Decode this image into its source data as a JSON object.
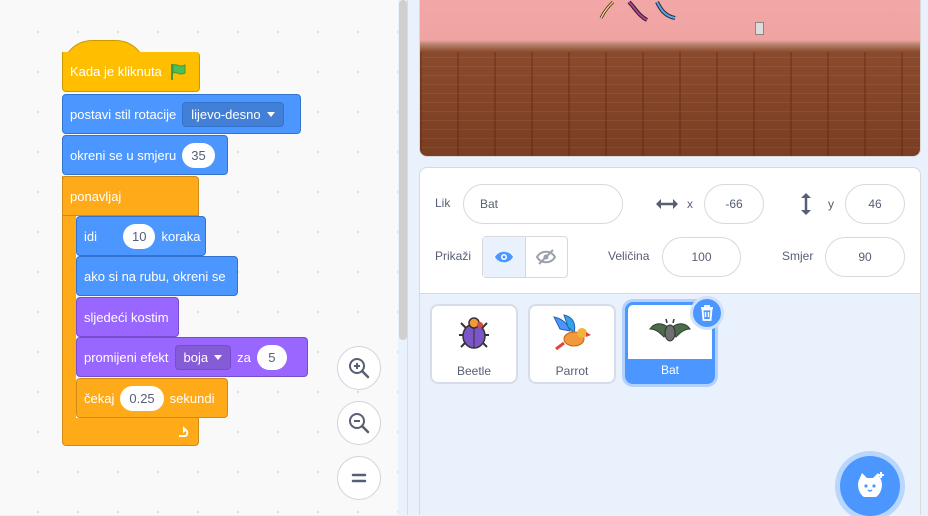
{
  "code": {
    "when_flag": "Kada je kliknuta",
    "set_rotation": {
      "label": "postavi stil rotacije",
      "value": "lijevo-desno"
    },
    "point": {
      "label": "okreni se u smjeru",
      "value": "35"
    },
    "forever": "ponavljaj",
    "move": {
      "pre": "idi",
      "value": "10",
      "post": "koraka"
    },
    "bounce": "ako si na rubu, okreni se",
    "next_costume": "sljedeći kostim",
    "change_effect": {
      "label": "promijeni efekt",
      "effect": "boja",
      "by": "za",
      "value": "5"
    },
    "wait": {
      "pre": "čekaj",
      "value": "0.25",
      "post": "sekundi"
    }
  },
  "sprite_info": {
    "sprite_label": "Lik",
    "sprite_name": "Bat",
    "x_label": "x",
    "x_value": "-66",
    "y_label": "y",
    "y_value": "46",
    "show_label": "Prikaži",
    "size_label": "Veličina",
    "size_value": "100",
    "direction_label": "Smjer",
    "direction_value": "90"
  },
  "sprites": [
    {
      "name": "Beetle",
      "selected": false
    },
    {
      "name": "Parrot",
      "selected": false
    },
    {
      "name": "Bat",
      "selected": true
    }
  ],
  "colors": {
    "motion": "#4c97ff",
    "looks": "#9966ff",
    "control": "#ffab19",
    "events": "#ffbf00",
    "selected": "#4c97ff"
  }
}
